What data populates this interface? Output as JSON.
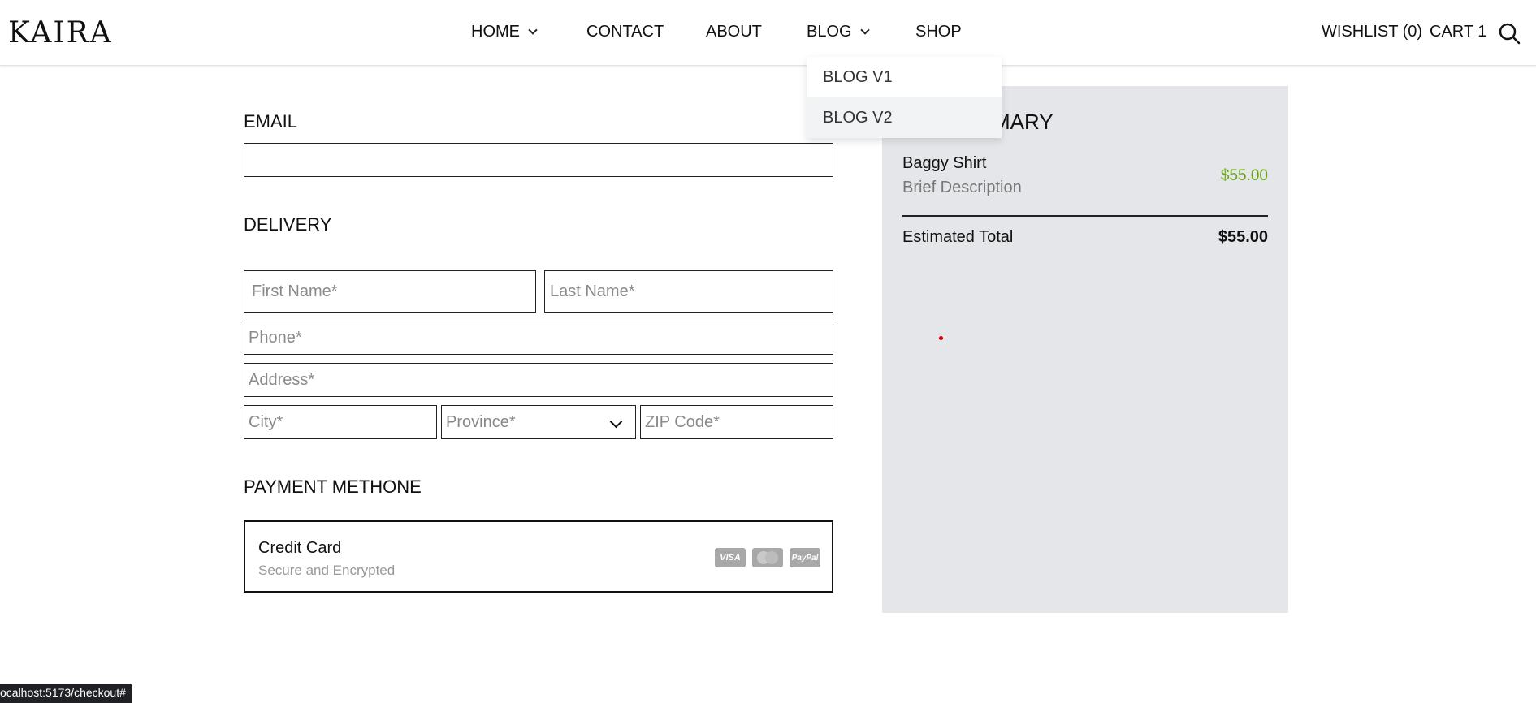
{
  "brand": {
    "logo": "KAIRA"
  },
  "nav": {
    "home": "HOME",
    "contact": "CONTACT",
    "about": "ABOUT",
    "blog": "BLOG",
    "shop": "SHOP"
  },
  "header_links": {
    "wishlist": "WISHLIST (0)",
    "cart": "CART 1"
  },
  "blog_dropdown": {
    "items": [
      "BLOG V1",
      "BLOG V2"
    ],
    "highlighted": "BLOG V2"
  },
  "form": {
    "email_title": "EMAIL",
    "email_value": "",
    "delivery_title": "DELIVERY",
    "first_name_placeholder": "First Name*",
    "last_name_placeholder": "Last Name*",
    "phone_placeholder": "Phone*",
    "address_placeholder": "Address*",
    "city_placeholder": "City*",
    "province_placeholder": "Province*",
    "zip_placeholder": "ZIP Code*",
    "payment_title": "PAYMENT METHONE",
    "payment_option": {
      "title": "Credit Card",
      "subtitle": "Secure and Encrypted",
      "icons": [
        "visa-icon",
        "mastercard-icon",
        "paypal-icon"
      ],
      "visa_text": "VISA",
      "paypal_text": "PayPal"
    }
  },
  "summary": {
    "title_visible": "MARY",
    "item": {
      "name": "Baggy Shirt",
      "description": "Brief Description",
      "price": "$55.00"
    },
    "total_label": "Estimated Total",
    "total_value": "$55.00"
  },
  "status_bar": {
    "url": "ocalhost:5173/checkout#"
  },
  "colors": {
    "price_green": "#6aa319",
    "summary_bg": "#e5e6e9",
    "dropdown_highlight": "#f2f3f5"
  }
}
